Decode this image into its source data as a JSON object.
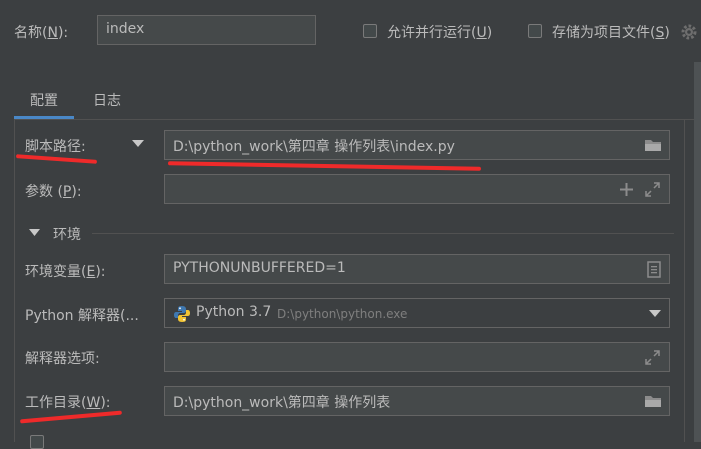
{
  "name_row": {
    "label": "名称(",
    "label_key": "N",
    "label_end": "):",
    "value": "index",
    "allow_parallel": {
      "label": "允许并行运行(",
      "key": "U",
      "end": ")",
      "checked": false
    },
    "store_as_project": {
      "label": "存储为项目文件(",
      "key": "S",
      "end": ")",
      "checked": false
    }
  },
  "tabs": [
    {
      "label": "配置",
      "active": true
    },
    {
      "label": "日志",
      "active": false
    }
  ],
  "script_path": {
    "label": "脚本路径:",
    "value": "D:\\python_work\\第四章 操作列表\\index.py"
  },
  "params": {
    "label": "参数 (",
    "key": "P",
    "end": "):",
    "value": ""
  },
  "env_section": {
    "title": "环境"
  },
  "env_vars": {
    "label": "环境变量(",
    "key": "E",
    "end": "):",
    "value": "PYTHONUNBUFFERED=1"
  },
  "interpreter": {
    "label": "Python 解释器(...",
    "name": "Python 3.7",
    "path": "D:\\python\\python.exe"
  },
  "interpreter_options": {
    "label": "解释器选项:",
    "value": ""
  },
  "working_dir": {
    "label": "工作目录(",
    "key": "W",
    "end": "):",
    "value": "D:\\python_work\\第四章 操作列表"
  },
  "colors": {
    "accent": "#4a88c7",
    "annotation": "#ef2a2a",
    "background": "#3c3f41",
    "field": "#45494a"
  }
}
